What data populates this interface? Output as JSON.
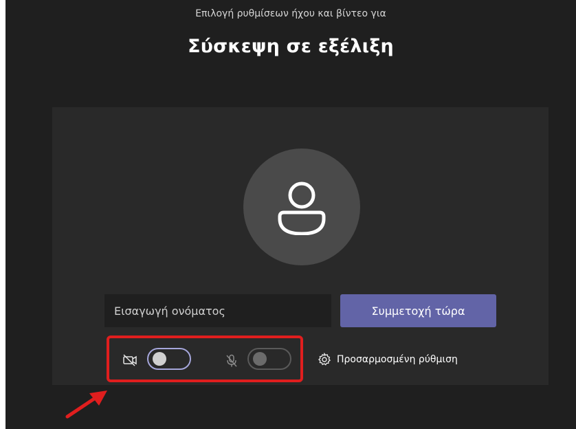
{
  "header": {
    "subtitle": "Επιλογή ρυθμίσεων ήχου και βίντεο για",
    "title": "Σύσκεψη σε εξέλιξη"
  },
  "prejoin": {
    "avatar_icon": "person-icon",
    "name_input": {
      "placeholder": "Εισαγωγή ονόματος",
      "value": ""
    },
    "join_label": "Συμμετοχή τώρα"
  },
  "devices": {
    "video": {
      "icon": "video-off-icon",
      "enabled": false
    },
    "mic": {
      "icon": "mic-off-icon",
      "enabled": false
    },
    "custom_setup_label": "Προσαρμοσμένη ρύθμιση",
    "custom_setup_icon": "gear-icon"
  },
  "colors": {
    "background": "#1f1f1f",
    "panel": "#292929",
    "accent": "#6264a7",
    "annotation": "#e01e1e"
  }
}
